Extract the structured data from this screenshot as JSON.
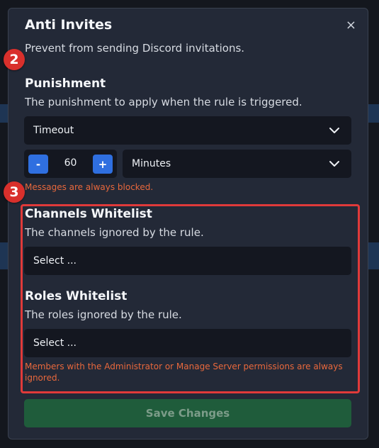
{
  "modal": {
    "title": "Anti Invites",
    "close_icon": "×",
    "description": "Prevent from sending Discord invitations."
  },
  "punishment": {
    "title": "Punishment",
    "description": "The punishment to apply when the rule is triggered.",
    "selected": "Timeout",
    "duration": {
      "minus_label": "-",
      "value": "60",
      "plus_label": "+",
      "unit": "Minutes"
    },
    "note": "Messages are always blocked."
  },
  "channels_whitelist": {
    "title": "Channels Whitelist",
    "description": "The channels ignored by the rule.",
    "placeholder": "Select ..."
  },
  "roles_whitelist": {
    "title": "Roles Whitelist",
    "description": "The roles ignored by the rule.",
    "placeholder": "Select ...",
    "note": "Members with the Administrator or Manage Server permissions are always ignored."
  },
  "markers": {
    "step_2": "2",
    "step_3": "3"
  },
  "save_button": {
    "label": "Save Changes"
  },
  "colors": {
    "accent_blue": "#2f6fe0",
    "warning": "#e8683c",
    "highlight_red": "#e03a3a",
    "save_green": "#1f5c3b"
  }
}
